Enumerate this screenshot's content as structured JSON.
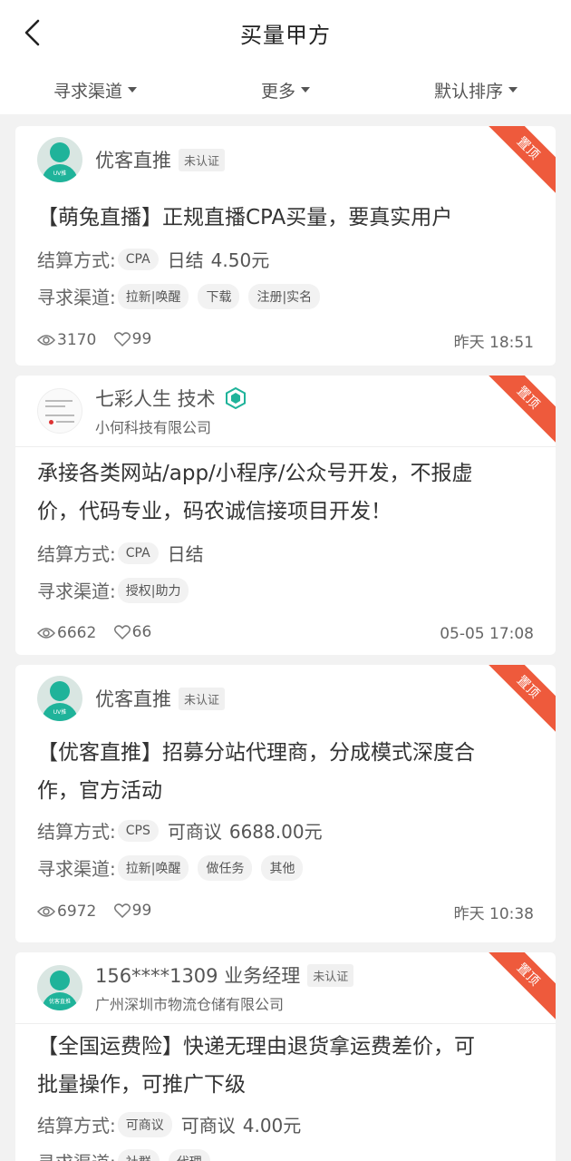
{
  "header": {
    "title": "买量甲方"
  },
  "filters": [
    {
      "label": "寻求渠道"
    },
    {
      "label": "更多"
    },
    {
      "label": "默认排序"
    }
  ],
  "labels": {
    "settlement": "结算方式:",
    "channel": "寻求渠道:",
    "pinned": "置顶"
  },
  "cards": [
    {
      "user": "优客直推",
      "verify_tag": "未认证",
      "avatar_text": "UV推",
      "title_line1": "【萌兔直播】正规直播CPA买量，要真实用户",
      "title_line2": "",
      "settle_type": "CPA",
      "settle_cycle": "日结",
      "price": "4.50元",
      "channels": [
        "拉新|唤醒",
        "下载",
        "注册|实名"
      ],
      "views": "3170",
      "likes": "99",
      "time": "昨天 18:51"
    },
    {
      "user": "七彩人生 技术",
      "company": "小何科技有限公司",
      "title_line1": "承接各类网站/app/小程序/公众号开发，不报虚",
      "title_line2": "价，代码专业，码农诚信接项目开发！",
      "settle_type": "CPA",
      "settle_cycle": "日结",
      "channels": [
        "授权|助力"
      ],
      "views": "6662",
      "likes": "66",
      "time": "05-05 17:08"
    },
    {
      "user": "优客直推",
      "verify_tag": "未认证",
      "avatar_text": "UV推",
      "title_line1": "【优客直推】招募分站代理商，分成模式深度合",
      "title_line2": "作，官方活动",
      "settle_type": "CPS",
      "settle_cycle": "可商议",
      "price": "6688.00元",
      "channels": [
        "拉新|唤醒",
        "做任务",
        "其他"
      ],
      "views": "6972",
      "likes": "99",
      "time": "昨天 10:38"
    },
    {
      "user": "156****1309 业务经理",
      "verify_tag": "未认证",
      "company": "广州深圳市物流仓储有限公司",
      "avatar_text": "优客直推",
      "title_line1": "【全国运费险】快递无理由退货拿运费差价，可",
      "title_line2": "批量操作，可推广下级",
      "settle_type": "可商议",
      "settle_cycle": "可商议",
      "price": "4.00元",
      "channels": [
        "社群",
        "代理"
      ]
    }
  ],
  "colors": {
    "accent": "#1fb39a",
    "ribbon": "#ee5a3c"
  }
}
